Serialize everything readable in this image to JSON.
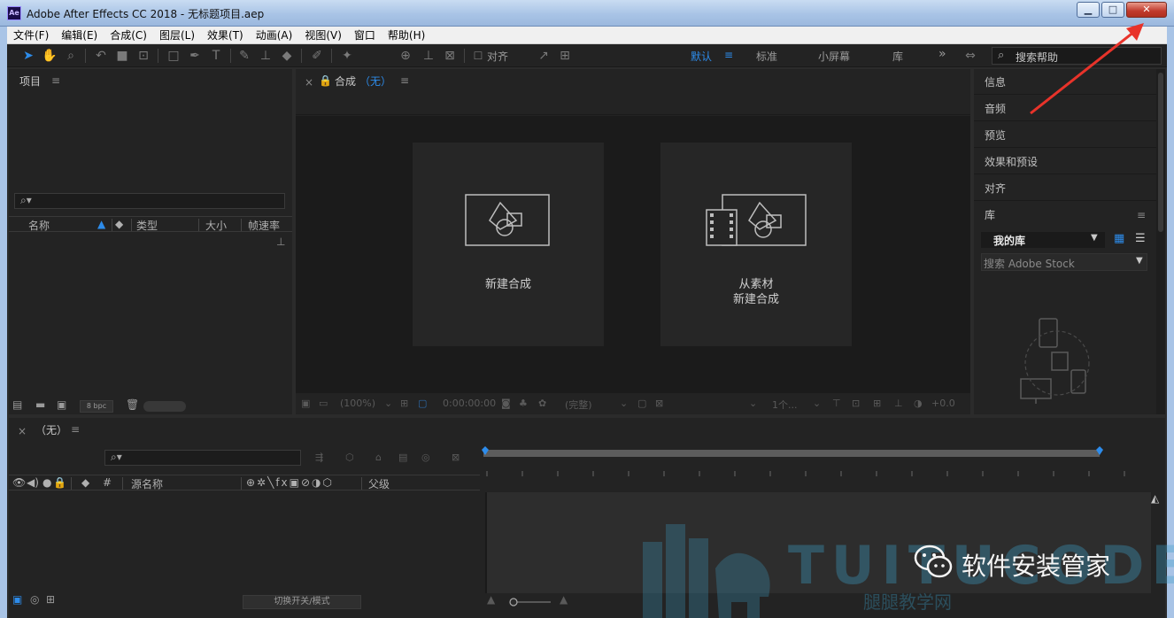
{
  "window": {
    "app_icon": "Ae",
    "title": "Adobe After Effects CC 2018 - 无标题项目.aep",
    "minimize": "▁",
    "maximize": "□",
    "close": "✕"
  },
  "menu": [
    "文件(F)",
    "编辑(E)",
    "合成(C)",
    "图层(L)",
    "效果(T)",
    "动画(A)",
    "视图(V)",
    "窗口",
    "帮助(H)"
  ],
  "toolbar": {
    "align_label": "对齐",
    "workspaces": [
      "默认",
      "标准",
      "小屏幕",
      "库"
    ],
    "more": "»",
    "help_search_placeholder": "搜索帮助"
  },
  "project": {
    "title": "项目",
    "menu_icon": "≡",
    "search_icon": "⌕▾",
    "columns": [
      "名称",
      "类型",
      "大小",
      "帧速率"
    ],
    "bpc": "8 bpc"
  },
  "composition": {
    "title": "合成",
    "name": "（无）",
    "menu_icon": "≡",
    "new_comp_label": "新建合成",
    "from_footage_line1": "从素材",
    "from_footage_line2": "新建合成",
    "footer": {
      "zoom": "(100%)",
      "timecode": "0:00:00:00",
      "resolution": "(完整)",
      "views": "1个...",
      "exposure": "+0.0"
    }
  },
  "right_panel": {
    "items": [
      "信息",
      "音频",
      "预览",
      "效果和预设",
      "对齐"
    ],
    "library_title": "库",
    "library_menu": "≡",
    "library_name": "我的库",
    "library_search_placeholder": "搜索 Adobe Stock"
  },
  "timeline": {
    "close": "×",
    "title": "（无）",
    "menu_icon": "≡",
    "search_icon": "⌕▾",
    "columns": [
      "#",
      "源名称",
      "父级"
    ],
    "switch_toggle": "切换开关/模式"
  },
  "watermark": {
    "brand": "软件安装管家",
    "tuitu": "TUITUCODE",
    "sub": "腿腿教学网"
  }
}
